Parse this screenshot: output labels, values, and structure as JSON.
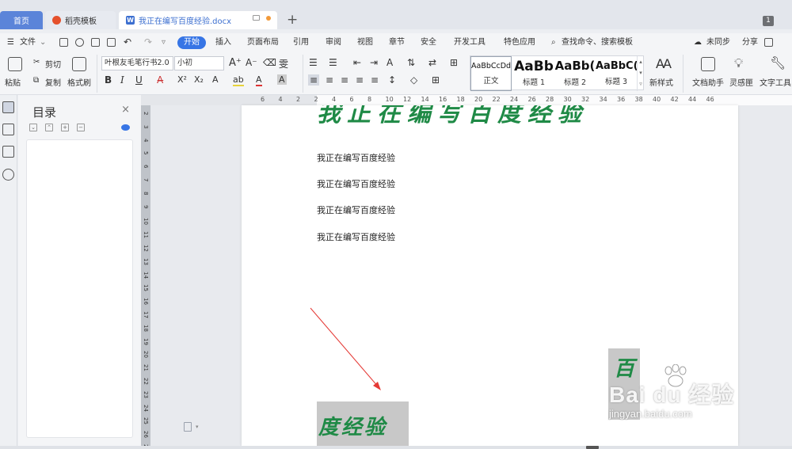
{
  "tabs": {
    "home": "首页",
    "template": "稻壳模板",
    "document": "我正在编写百度经验.docx",
    "new_tab": "+",
    "badge": "1"
  },
  "menu": {
    "file": "文件",
    "start": "开始",
    "insert": "插入",
    "page_layout": "页面布局",
    "reference": "引用",
    "review": "审阅",
    "view": "视图",
    "chapter": "章节",
    "security": "安全",
    "dev_tools": "开发工具",
    "special_apps": "特色应用",
    "search": "查找命令、搜索模板",
    "sync": "未同步",
    "share": "分享"
  },
  "ribbon": {
    "paste": "粘贴",
    "cut": "剪切",
    "copy": "复制",
    "format_painter": "格式刷",
    "font_name": "叶根友毛笔行书2.0",
    "font_size": "小初",
    "bold": "B",
    "italic": "I",
    "underline": "U",
    "styles": [
      {
        "sample": "AaBbCcDd",
        "name": "正文"
      },
      {
        "sample": "AaBb",
        "name": "标题 1"
      },
      {
        "sample": "AaBb(",
        "name": "标题 2"
      },
      {
        "sample": "AaBbC(",
        "name": "标题 3"
      }
    ],
    "new_style": "新样式",
    "doc_assistant": "文档助手",
    "inspiration": "灵感匣",
    "text_tools": "文字工具"
  },
  "ruler": {
    "h_numbers": [
      "6",
      "4",
      "2",
      "2",
      "4",
      "6",
      "8",
      "10",
      "12",
      "14",
      "16",
      "18",
      "20",
      "22",
      "24",
      "26",
      "28",
      "30",
      "32",
      "34",
      "36",
      "38",
      "40",
      "42",
      "44",
      "46"
    ],
    "v_numbers": [
      "2",
      "3",
      "4",
      "5",
      "6",
      "7",
      "8",
      "9",
      "10",
      "11",
      "12",
      "13",
      "14",
      "15",
      "16",
      "17",
      "18",
      "19",
      "20",
      "21",
      "22",
      "23",
      "24",
      "25",
      "26",
      "27"
    ]
  },
  "toc": {
    "title": "目录",
    "close": "×"
  },
  "document": {
    "heading_art": "我正在编写百度经验",
    "lines": [
      "我正在编写百度经验",
      "我正在编写百度经验",
      "我正在编写百度经验",
      "我正在编写百度经验"
    ],
    "image_left_text": "度经验",
    "image_right_text": "百"
  },
  "watermark": {
    "main": "Bai du 经验",
    "sub": "jingyan.baidu.com"
  },
  "colors": {
    "accent": "#3775e5",
    "art_green": "#1f8a46",
    "arrow_red": "#e53935"
  }
}
